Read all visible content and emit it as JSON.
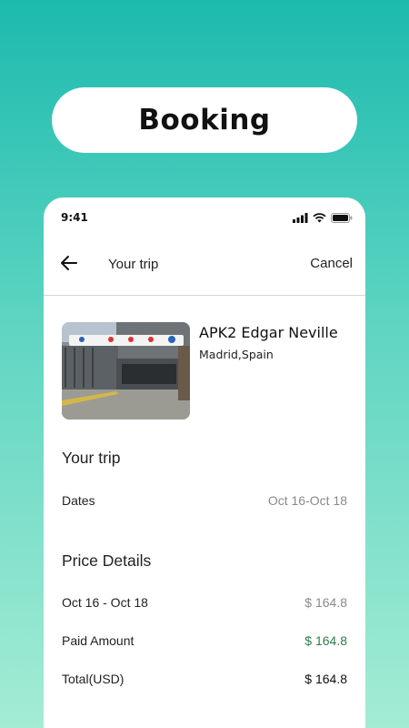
{
  "banner": {
    "title": "Booking"
  },
  "status_bar": {
    "time": "9:41",
    "icons": [
      "signal-icon",
      "wifi-icon",
      "battery-icon"
    ]
  },
  "app_bar": {
    "back_icon": "arrow-left-icon",
    "title": "Your trip",
    "cancel_label": "Cancel"
  },
  "listing": {
    "image": "parking-garage-entrance-photo",
    "name": "APK2 Edgar Neville",
    "location": "Madrid,Spain"
  },
  "trip": {
    "heading": "Your trip",
    "dates_label": "Dates",
    "dates_value": "Oct 16-Oct 18"
  },
  "price_details": {
    "heading": "Price Details",
    "rows": [
      {
        "label": "Oct 16 - Oct 18",
        "value": "$ 164.8",
        "color": "#8a8a8a"
      },
      {
        "label": "Paid Amount",
        "value": "$ 164.8",
        "color": "#2e7d4a"
      },
      {
        "label": "Total(USD)",
        "value": "$ 164.8",
        "color": "#111111"
      }
    ]
  },
  "colors": {
    "background_top": "#1cbaae",
    "background_bottom": "#a4ecd4",
    "paid_green": "#2e7d4a"
  }
}
